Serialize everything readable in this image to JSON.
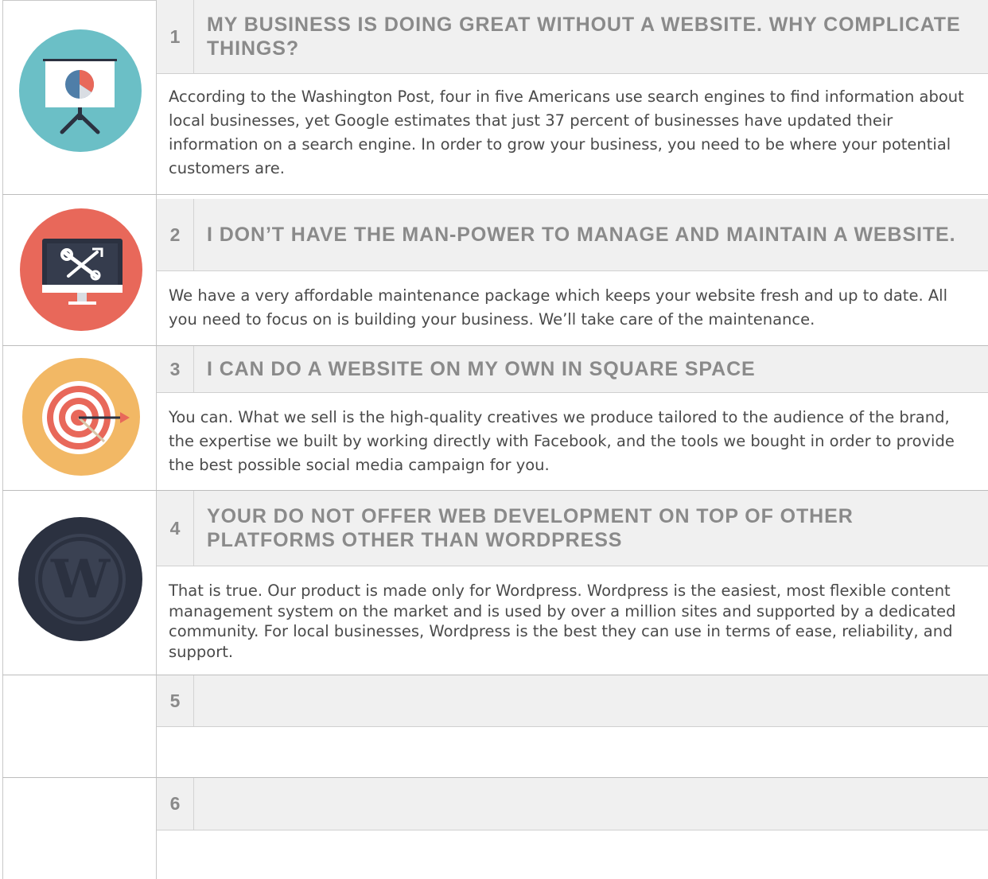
{
  "faq": [
    {
      "number": "1",
      "question": "MY BUSINESS IS DOING GREAT WITHOUT A WEBSITE. WHY COMPLICATE THINGS?",
      "answer": "According to the Washington Post, four in five Americans use search engines to find information about local businesses, yet Google estimates that just 37 percent of businesses have updated their information on a search engine. In order to grow your business, you need to be where your potential customers are.",
      "icon": "presentation-chart-icon"
    },
    {
      "number": "2",
      "question": "I DON’T HAVE THE MAN-POWER TO MANAGE AND MAINTAIN A WEBSITE.",
      "answer": "We have a very affordable maintenance package which keeps your website fresh and up to date. All you need to focus on is building your business. We’ll take care of the maintenance.",
      "icon": "monitor-tools-icon"
    },
    {
      "number": "3",
      "question": "I CAN DO A WEBSITE ON MY OWN IN SQUARE SPACE",
      "answer": "You can. What we sell is the high-quality creatives we produce tailored to the audience of the brand, the expertise we built by working directly with Facebook, and the tools we bought in order to provide the best possible social media campaign for you.",
      "icon": "target-icon"
    },
    {
      "number": "4",
      "question": "YOUR DO NOT OFFER WEB DEVELOPMENT ON TOP OF OTHER PLATFORMS OTHER THAN WORDPRESS",
      "answer": "That is true. Our product is made only for Wordpress. Wordpress is the easiest, most flexible content management system on the market and is used by over a million sites and supported by a dedicated community. For local businesses, Wordpress is the best they can use in terms of ease, reliability, and support.",
      "icon": "wordpress-icon"
    },
    {
      "number": "5",
      "question": "",
      "answer": ""
    },
    {
      "number": "6",
      "question": "",
      "answer": ""
    }
  ],
  "colors": {
    "header_bg": "#f0f0f0",
    "heading_text": "#8a8a8a",
    "body_text": "#4a4a4a",
    "teal": "#6bbfc6",
    "coral": "#e8685a",
    "amber": "#f2b865",
    "navy": "#2b3140"
  }
}
